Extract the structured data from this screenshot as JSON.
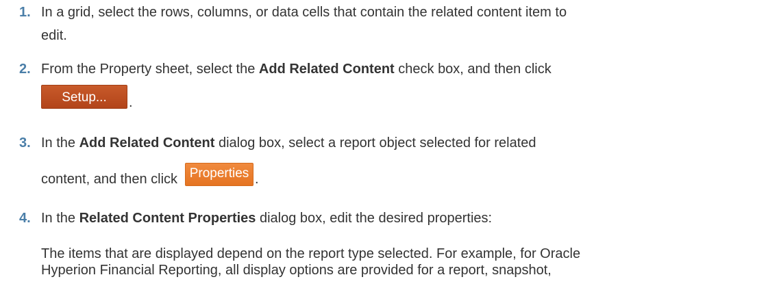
{
  "steps": [
    {
      "num": "1.",
      "lines": [
        "In a grid, select the rows, columns, or data cells that contain the related content item to",
        "edit."
      ]
    },
    {
      "num": "2.",
      "pre": "From the Property sheet, select the ",
      "bold": "Add Related Content",
      "post": " check box, and then click",
      "button": "Setup...",
      "tail": "."
    },
    {
      "num": "3.",
      "pre": "In the ",
      "bold": "Add Related Content",
      "post": " dialog box, select a report object selected for related",
      "line2": "content, and then click",
      "button": "Properties",
      "tail": "."
    },
    {
      "num": "4.",
      "pre": "In the ",
      "bold": "Related Content Properties",
      "post": " dialog box, edit the desired properties:",
      "para": [
        "The items that are displayed depend on the report type selected. For example, for Oracle",
        "Hyperion Financial Reporting, all display options are provided for a report, snapshot,"
      ]
    }
  ]
}
